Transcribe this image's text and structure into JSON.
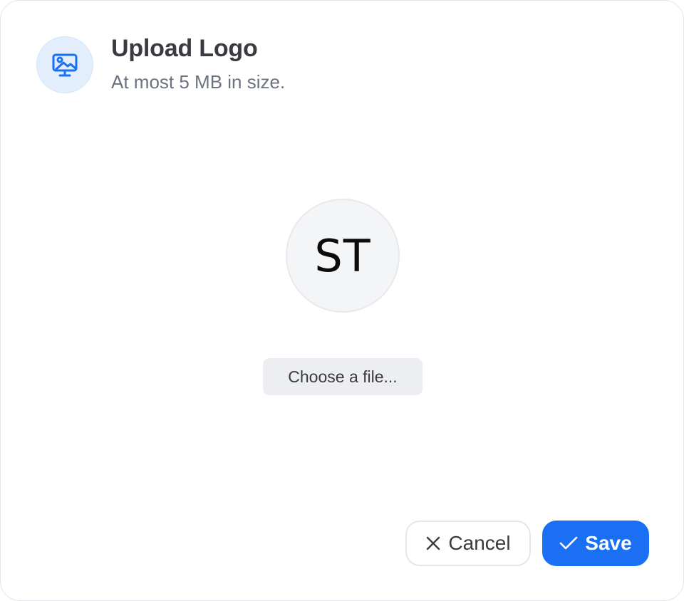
{
  "dialog": {
    "title": "Upload Logo",
    "subtitle": "At most 5 MB in size.",
    "header_icon": "image-monitor-icon"
  },
  "avatar": {
    "initials": "ST"
  },
  "file_picker": {
    "label": "Choose a file..."
  },
  "actions": {
    "cancel_label": "Cancel",
    "cancel_icon": "close-icon",
    "save_label": "Save",
    "save_icon": "check-icon"
  },
  "colors": {
    "accent": "#1a6ff2",
    "icon_bg": "#e3eefd",
    "title_text": "#3a3a40",
    "muted_text": "#6b7280"
  }
}
